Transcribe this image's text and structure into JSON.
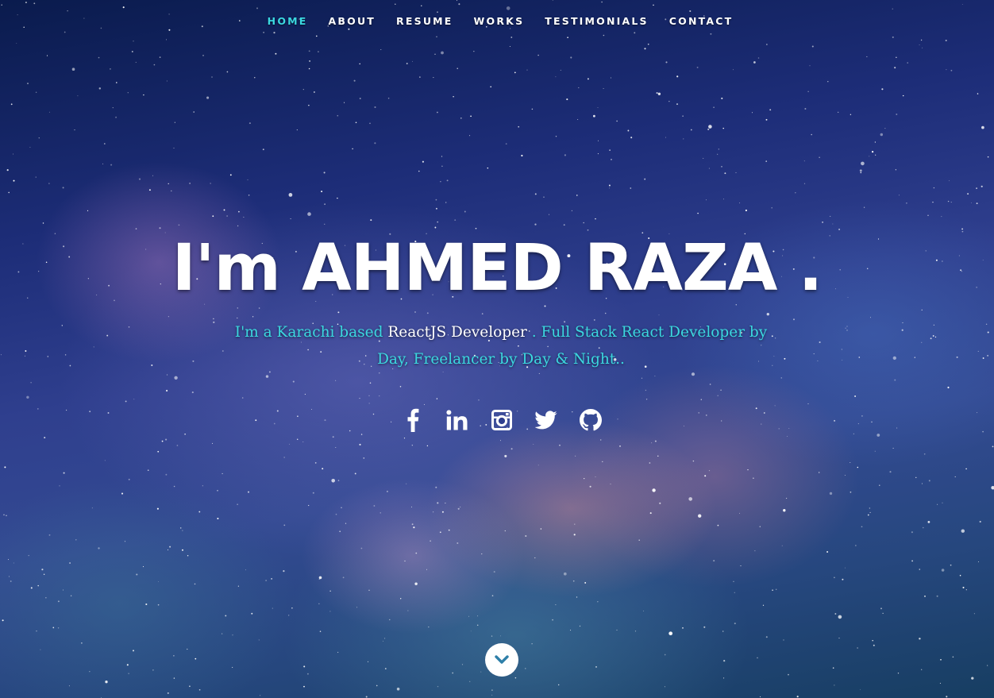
{
  "nav": {
    "items": [
      {
        "label": "HOME",
        "active": true
      },
      {
        "label": "ABOUT",
        "active": false
      },
      {
        "label": "RESUME",
        "active": false
      },
      {
        "label": "WORKS",
        "active": false
      },
      {
        "label": "TESTIMONIALS",
        "active": false
      },
      {
        "label": "CONTACT",
        "active": false
      }
    ]
  },
  "hero": {
    "headline": "I'm AHMED RAZA .",
    "tagline_prefix": "I'm a Karachi based ",
    "tagline_role": "ReactJS Developer",
    "tagline_suffix": " . Full Stack React Developer by Day, Freelancer by Day & Night.."
  },
  "social": [
    {
      "icon": "facebook-icon"
    },
    {
      "icon": "linkedin-icon"
    },
    {
      "icon": "instagram-icon"
    },
    {
      "icon": "twitter-icon"
    },
    {
      "icon": "github-icon"
    }
  ],
  "scroll": {
    "icon": "chevron-down-icon"
  },
  "colors": {
    "accent": "#3bd8e0",
    "text": "#ffffff",
    "sky_top": "#0a1b4d",
    "sky_bottom": "#173e62"
  }
}
